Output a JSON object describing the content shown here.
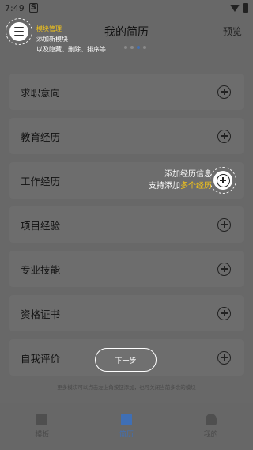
{
  "status_bar": {
    "time": "7:49",
    "notification_icon": "S"
  },
  "header": {
    "title": "我的简历",
    "preview": "预览"
  },
  "tip_menu": {
    "line1": "模块管理",
    "line2": "添加新模块",
    "line3": "以及隐藏、删除、排序等"
  },
  "sections": [
    {
      "label": "求职意向"
    },
    {
      "label": "教育经历"
    },
    {
      "label": "工作经历"
    },
    {
      "label": "项目经验"
    },
    {
      "label": "专业技能"
    },
    {
      "label": "资格证书"
    },
    {
      "label": "自我评价"
    }
  ],
  "tip_add": {
    "line1": "添加经历信息",
    "line2_prefix": "支持添加",
    "line2_highlight": "多个经历"
  },
  "next_button": "下一步",
  "footer_note": "更多模块可以点击左上角按钮添加，也可关闭当前多余的模块",
  "tabs": [
    {
      "label": "模板",
      "icon": "template-icon",
      "active": false
    },
    {
      "label": "简历",
      "icon": "resume-icon",
      "active": true
    },
    {
      "label": "我的",
      "icon": "profile-icon",
      "active": false
    }
  ],
  "colors": {
    "overlay": "#686868",
    "highlight": "#f5c518",
    "accent": "#3f6fb5"
  }
}
